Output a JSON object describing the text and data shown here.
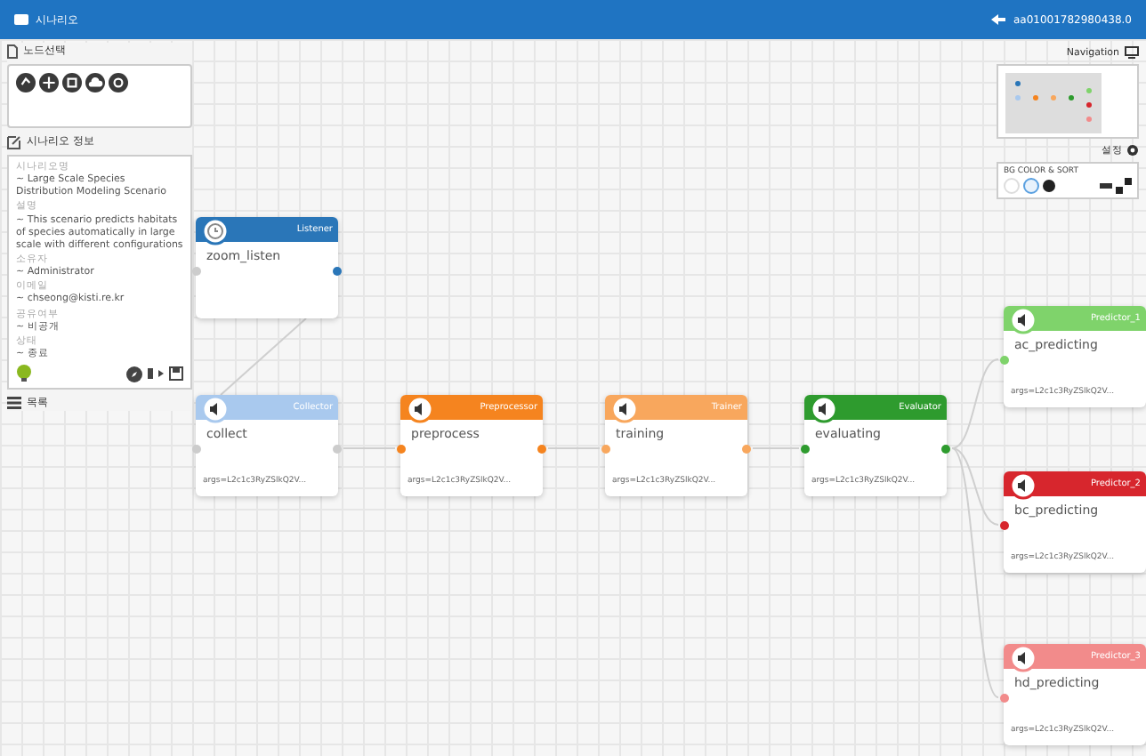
{
  "app_bar": {
    "title": "시나리오",
    "user": "aa01001782980438.0"
  },
  "node_select": {
    "title": "노드선택"
  },
  "scenario_info": {
    "title": "시나리오 정보",
    "fields": [
      {
        "label": "시나리오명",
        "value": "~ Large Scale Species Distribution Modeling Scenario"
      },
      {
        "label": "설명",
        "value": "~ This scenario predicts habitats of species automatically in large scale with different configurations"
      },
      {
        "label": "소유자",
        "value": "~ Administrator"
      },
      {
        "label": "이메일",
        "value": "~ chseong@kisti.re.kr"
      },
      {
        "label": "공유여부",
        "value": "~ 비공개"
      },
      {
        "label": "상태",
        "value": "~ 종료"
      }
    ]
  },
  "list_section": {
    "title": "목록"
  },
  "navigation": {
    "title": "Navigation"
  },
  "settings": {
    "label": "설정"
  },
  "bg_panel": {
    "title": "BG COLOR & SORT"
  },
  "nodes": [
    {
      "kind": "listener",
      "type": "Listener",
      "name": "zoom_listen",
      "color": "#2a76b8"
    },
    {
      "kind": "task",
      "type": "Collector",
      "name": "collect",
      "color": "#a9c9ee",
      "arg": "args=L2c1c3RyZSlkQ2V..."
    },
    {
      "kind": "task",
      "type": "Preprocessor",
      "name": "preprocess",
      "color": "#f5841f",
      "arg": "args=L2c1c3RyZSlkQ2V..."
    },
    {
      "kind": "task",
      "type": "Trainer",
      "name": "training",
      "color": "#f8a75d",
      "arg": "args=L2c1c3RyZSlkQ2V..."
    },
    {
      "kind": "task",
      "type": "Evaluator",
      "name": "evaluating",
      "color": "#2e9b2e",
      "arg": "args=L2c1c3RyZSlkQ2V..."
    },
    {
      "kind": "task",
      "type": "Predictor_1",
      "name": "ac_predicting",
      "color": "#7fd36b",
      "arg": "args=L2c1c3RyZSlkQ2V..."
    },
    {
      "kind": "task",
      "type": "Predictor_2",
      "name": "bc_predicting",
      "color": "#d7262d",
      "arg": "args=L2c1c3RyZSlkQ2V..."
    },
    {
      "kind": "task",
      "type": "Predictor_3",
      "name": "hd_predicting",
      "color": "#f28b8b",
      "arg": "args=L2c1c3RyZSlkQ2V..."
    }
  ]
}
